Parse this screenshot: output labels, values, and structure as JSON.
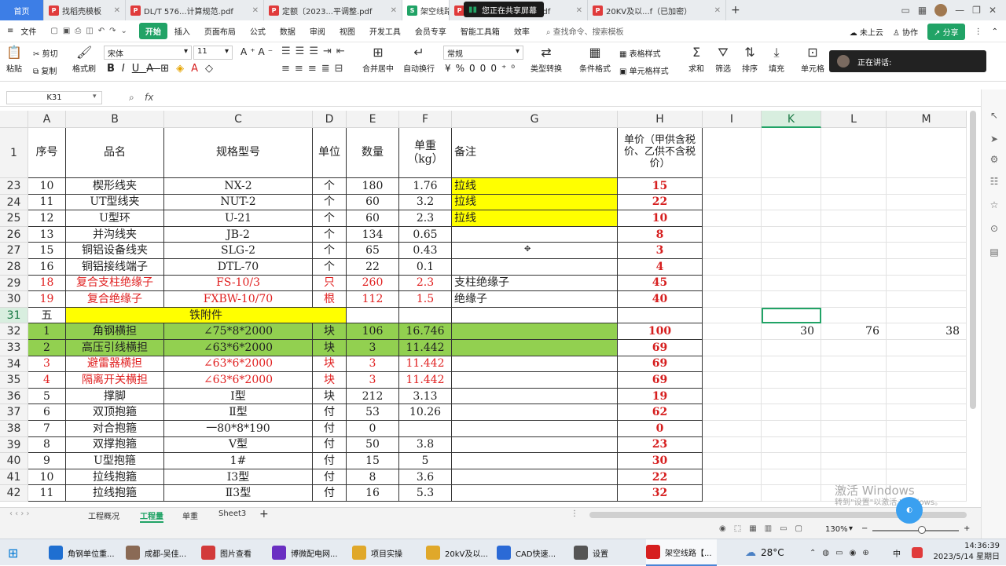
{
  "tabs": [
    {
      "label": "首页",
      "icon": "home-tab"
    },
    {
      "label": "找稻壳模板",
      "icon": "docer-icon",
      "color": "#e03b3b"
    },
    {
      "label": "DL/T 576...计算规范.pdf",
      "icon": "pdf-icon",
      "color": "#e03b3b"
    },
    {
      "label": "定额〔2023...平调整.pdf",
      "icon": "pdf-icon",
      "color": "#e03b3b"
    },
    {
      "label": "架空线路",
      "icon": "sheet-icon",
      "color": "#21a366"
    },
    {
      "label": "建设预算编制...6版.pdf",
      "icon": "pdf-icon",
      "color": "#e03b3b"
    },
    {
      "label": "20KV及以...f（已加密）",
      "icon": "pdf-icon",
      "color": "#e03b3b"
    }
  ],
  "share_screen": "您正在共享屏幕",
  "menu": {
    "file": "文件",
    "items": [
      "开始",
      "插入",
      "页面布局",
      "公式",
      "数据",
      "审阅",
      "视图",
      "开发工具",
      "会员专享",
      "智能工具箱",
      "效率"
    ],
    "search": "查找命令、搜索模板",
    "cloud": "未上云",
    "collab": "协作",
    "share": "分享"
  },
  "ribbon": {
    "paste": "粘贴",
    "cut": "剪切",
    "copy": "复制",
    "format_painter": "格式刷",
    "font_name": "宋体",
    "font_size": "11",
    "number_format": "常规",
    "merge_center": "合并居中",
    "wrap_text": "自动换行",
    "type_convert": "类型转换",
    "cond_format": "条件格式",
    "table_style": "表格样式",
    "cell_style": "单元格样式",
    "sum": "求和",
    "filter": "筛选",
    "sort": "排序",
    "fill": "填充",
    "cell": "单元格"
  },
  "speaking": "正在讲话:",
  "namebox": "K31",
  "fx": "fx",
  "columns": [
    "A",
    "B",
    "C",
    "D",
    "E",
    "F",
    "G",
    "H",
    "I",
    "K",
    "L",
    "M"
  ],
  "header_row": {
    "row": "1",
    "cells": [
      "序号",
      "品名",
      "规格型号",
      "单位",
      "数量",
      "单重（kg）",
      "备注",
      "单价（甲供含税价、乙供不含税价）",
      "",
      "",
      "",
      ""
    ]
  },
  "rows": [
    {
      "row": "23",
      "cells": [
        "10",
        "楔形线夹",
        "NX-2",
        "个",
        "180",
        "1.76",
        "拉线",
        "15",
        "",
        "",
        "",
        ""
      ]
    },
    {
      "row": "24",
      "cells": [
        "11",
        "UT型线夹",
        "NUT-2",
        "个",
        "60",
        "3.2",
        "拉线",
        "22",
        "",
        "",
        "",
        ""
      ]
    },
    {
      "row": "25",
      "cells": [
        "12",
        "U型环",
        "U-21",
        "个",
        "60",
        "2.3",
        "拉线",
        "10",
        "",
        "",
        "",
        ""
      ]
    },
    {
      "row": "26",
      "cells": [
        "13",
        "并沟线夹",
        "JB-2",
        "个",
        "134",
        "0.65",
        "",
        "8",
        "",
        "",
        "",
        ""
      ]
    },
    {
      "row": "27",
      "cells": [
        "15",
        "铜铝设备线夹",
        "SLG-2",
        "个",
        "65",
        "0.43",
        "",
        "3",
        "",
        "",
        "",
        ""
      ]
    },
    {
      "row": "28",
      "cells": [
        "16",
        "铜铝接线端子",
        "DTL-70",
        "个",
        "22",
        "0.1",
        "",
        "4",
        "",
        "",
        "",
        ""
      ]
    },
    {
      "row": "29",
      "cells": [
        "18",
        "复合支柱绝缘子",
        "FS-10/3",
        "只",
        "260",
        "2.3",
        "支柱绝缘子",
        "45",
        "",
        "",
        "",
        ""
      ]
    },
    {
      "row": "30",
      "cells": [
        "19",
        "复合绝缘子",
        "FXBW-10/70",
        "根",
        "112",
        "1.5",
        "绝缘子",
        "40",
        "",
        "",
        "",
        ""
      ]
    },
    {
      "row": "31",
      "cells": [
        "五",
        "铁附件",
        "",
        "",
        "",
        "",
        "",
        "",
        "",
        "",
        "",
        ""
      ]
    },
    {
      "row": "32",
      "cells": [
        "1",
        "角钢横担",
        "∠75*8*2000",
        "块",
        "106",
        "16.746",
        "",
        "100",
        "",
        "30",
        "76",
        "38"
      ]
    },
    {
      "row": "33",
      "cells": [
        "2",
        "高压引线横担",
        "∠63*6*2000",
        "块",
        "3",
        "11.442",
        "",
        "69",
        "",
        "",
        "",
        ""
      ]
    },
    {
      "row": "34",
      "cells": [
        "3",
        "避雷器横担",
        "∠63*6*2000",
        "块",
        "3",
        "11.442",
        "",
        "69",
        "",
        "",
        "",
        ""
      ]
    },
    {
      "row": "35",
      "cells": [
        "4",
        "隔离开关横担",
        "∠63*6*2000",
        "块",
        "3",
        "11.442",
        "",
        "69",
        "",
        "",
        "",
        ""
      ]
    },
    {
      "row": "36",
      "cells": [
        "5",
        "撑脚",
        "Ⅰ型",
        "块",
        "212",
        "3.13",
        "",
        "19",
        "",
        "",
        "",
        ""
      ]
    },
    {
      "row": "37",
      "cells": [
        "6",
        "双顶抱箍",
        "Ⅱ型",
        "付",
        "53",
        "10.26",
        "",
        "62",
        "",
        "",
        "",
        ""
      ]
    },
    {
      "row": "38",
      "cells": [
        "7",
        "对合抱箍",
        "一80*8*190",
        "付",
        "0",
        "",
        "",
        "0",
        "",
        "",
        "",
        ""
      ]
    },
    {
      "row": "39",
      "cells": [
        "8",
        "双撑抱箍",
        "Ⅴ型",
        "付",
        "50",
        "3.8",
        "",
        "23",
        "",
        "",
        "",
        ""
      ]
    },
    {
      "row": "40",
      "cells": [
        "9",
        "U型抱箍",
        "1#",
        "付",
        "15",
        "5",
        "",
        "30",
        "",
        "",
        "",
        ""
      ]
    },
    {
      "row": "41",
      "cells": [
        "10",
        "拉线抱箍",
        "Ⅰ3型",
        "付",
        "8",
        "3.6",
        "",
        "22",
        "",
        "",
        "",
        ""
      ]
    },
    {
      "row": "42",
      "cells": [
        "11",
        "拉线抱箍",
        "Ⅱ3型",
        "付",
        "16",
        "5.3",
        "",
        "32",
        "",
        "",
        "",
        ""
      ]
    }
  ],
  "sheets": [
    "工程概况",
    "工程量",
    "单重",
    "Sheet3"
  ],
  "active_sheet": "工程量",
  "zoom": "130%",
  "watermark": {
    "line1": "激活 Windows",
    "line2": "转到\"设置\"以激活 Windows。"
  },
  "taskbar": [
    {
      "label": "角钢单位重...",
      "color": "#1f6fd1"
    },
    {
      "label": "成都-吴佳...",
      "color": "#8a6a55"
    },
    {
      "label": "图片查看",
      "color": "#d23a3a"
    },
    {
      "label": "博微配电网...",
      "color": "#6a2fc2"
    },
    {
      "label": "项目实操",
      "color": "#e0a82a"
    },
    {
      "label": "20kV及以...",
      "color": "#e0a82a"
    },
    {
      "label": "CAD快速...",
      "color": "#2b6ad6"
    },
    {
      "label": "设置",
      "color": "#555555"
    },
    {
      "label": "架空线路【...",
      "color": "#d61f1f"
    }
  ],
  "weather": "28°C",
  "ime": "中",
  "time": "14:36:39",
  "date": "2023/5/14 星期日"
}
